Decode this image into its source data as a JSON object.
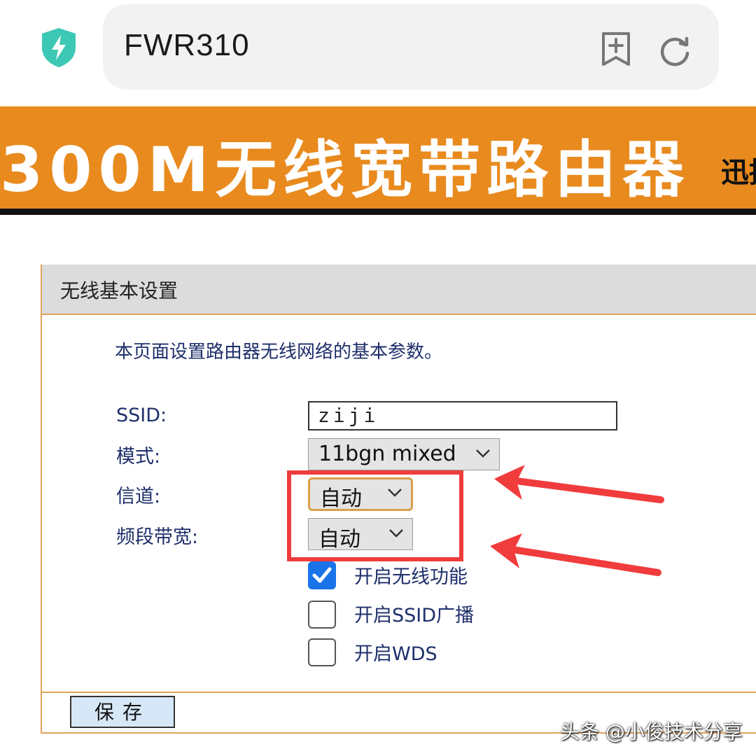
{
  "browser": {
    "url": "FWR310",
    "icons": [
      "shield-bolt-icon",
      "bookmark-add-icon",
      "reload-icon"
    ]
  },
  "banner": {
    "title": "300M无线宽带路由器",
    "tail_text": "迅捷"
  },
  "panel": {
    "title": "无线基本设置",
    "description": "本页面设置路由器无线网络的基本参数。",
    "fields": {
      "ssid": {
        "label": "SSID:",
        "value": "ziji"
      },
      "mode": {
        "label": "模式:",
        "value": "11bgn mixed"
      },
      "channel": {
        "label": "信道:",
        "value": "自动"
      },
      "bandwidth": {
        "label": "频段带宽:",
        "value": "自动"
      }
    },
    "checkboxes": [
      {
        "label": "开启无线功能",
        "checked": true
      },
      {
        "label": "开启SSID广播",
        "checked": false
      },
      {
        "label": "开启WDS",
        "checked": false
      }
    ],
    "save_label": "保存"
  },
  "watermark": "头条 @小俊技术分享",
  "colors": {
    "banner": "#e88a1e",
    "panel_border": "#e3a45a",
    "label_text": "#1e2f6b",
    "highlight": "#f03c3c",
    "checkbox_checked": "#1a73e8"
  }
}
